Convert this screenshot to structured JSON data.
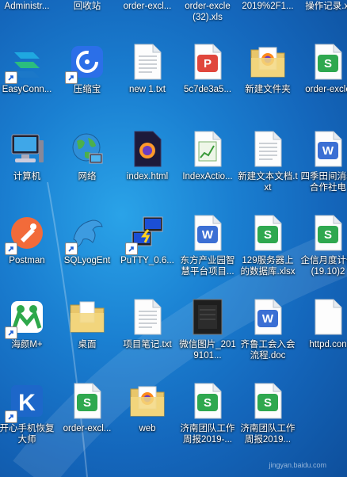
{
  "top_labels": [
    "Administr...",
    "回收站",
    "order-excl...",
    "order-excle\n(32).xls",
    "2019%2F1...",
    "操作记录.xl"
  ],
  "icons": [
    {
      "name": "desktop-icon-easyconnect",
      "label": "EasyConn...",
      "icon": "easyconnect-icon",
      "shortcut": true
    },
    {
      "name": "desktop-icon-yasuobao",
      "label": "压缩宝",
      "icon": "compress-icon",
      "shortcut": true
    },
    {
      "name": "desktop-icon-new1-txt",
      "label": "new 1.txt",
      "icon": "text-file-icon",
      "shortcut": false
    },
    {
      "name": "desktop-icon-5c7de3a5",
      "label": "5c7de3a5...",
      "icon": "ppt-file-icon",
      "shortcut": false
    },
    {
      "name": "desktop-icon-new-folder",
      "label": "新建文件夹",
      "icon": "folder-firefox-icon",
      "shortcut": false
    },
    {
      "name": "desktop-icon-order-excle-top",
      "label": "order-excle",
      "icon": "spreadsheet-icon",
      "shortcut": false
    },
    {
      "name": "desktop-icon-computer",
      "label": "计算机",
      "icon": "computer-icon",
      "shortcut": false
    },
    {
      "name": "desktop-icon-network",
      "label": "网络",
      "icon": "network-globe-icon",
      "shortcut": false
    },
    {
      "name": "desktop-icon-index-html",
      "label": "index.html",
      "icon": "firefox-file-icon",
      "shortcut": false
    },
    {
      "name": "desktop-icon-indexaction",
      "label": "IndexActio...",
      "icon": "chart-file-icon",
      "shortcut": false
    },
    {
      "name": "desktop-icon-new-txt-doc",
      "label": "新建文本文档.txt",
      "icon": "text-file-icon",
      "shortcut": false
    },
    {
      "name": "desktop-icon-sijitian",
      "label": "四季田间消着合作社电",
      "icon": "word-doc-icon",
      "shortcut": false
    },
    {
      "name": "desktop-icon-postman",
      "label": "Postman",
      "icon": "postman-icon",
      "shortcut": true
    },
    {
      "name": "desktop-icon-sqlyog",
      "label": "SQLyogEnt",
      "icon": "dolphin-icon",
      "shortcut": true
    },
    {
      "name": "desktop-icon-putty",
      "label": "PuTTY_0.6...",
      "icon": "putty-icon",
      "shortcut": true
    },
    {
      "name": "desktop-icon-dongfang",
      "label": "东方产业园智慧平台项目...",
      "icon": "word-doc-icon",
      "shortcut": false
    },
    {
      "name": "desktop-icon-129-server",
      "label": "129服务器上的数据库.xlsx",
      "icon": "spreadsheet-icon",
      "shortcut": false
    },
    {
      "name": "desktop-icon-qixinyue",
      "label": "企信月度计信(19.10)2",
      "icon": "spreadsheet-icon",
      "shortcut": false
    },
    {
      "name": "desktop-icon-haiyan",
      "label": "海颜M+",
      "icon": "haiyan-icon",
      "shortcut": true
    },
    {
      "name": "desktop-icon-zhuomian",
      "label": "桌面",
      "icon": "folder-doc-icon",
      "shortcut": false
    },
    {
      "name": "desktop-icon-xiangmu-biji",
      "label": "项目笔记.txt",
      "icon": "text-file-icon",
      "shortcut": false
    },
    {
      "name": "desktop-icon-weixin-pic",
      "label": "微信图片_2019101...",
      "icon": "image-thumb-icon",
      "shortcut": false
    },
    {
      "name": "desktop-icon-qilu-gonghui",
      "label": "齐鲁工会入会流程.doc",
      "icon": "word-doc-icon",
      "shortcut": false
    },
    {
      "name": "desktop-icon-httpd",
      "label": "httpd.con",
      "icon": "blank-file-icon",
      "shortcut": false
    },
    {
      "name": "desktop-icon-kaixin",
      "label": "开心手机恢复大师",
      "icon": "kaixin-icon",
      "shortcut": true
    },
    {
      "name": "desktop-icon-order-excl-bottom",
      "label": "order-excl...",
      "icon": "spreadsheet-icon",
      "shortcut": false
    },
    {
      "name": "desktop-icon-web",
      "label": "web",
      "icon": "folder-firefox-icon",
      "shortcut": false
    },
    {
      "name": "desktop-icon-jinan-1",
      "label": "济南团队工作周报2019-...",
      "icon": "spreadsheet-icon",
      "shortcut": false
    },
    {
      "name": "desktop-icon-jinan-2",
      "label": "济南团队工作周报2019...",
      "icon": "spreadsheet-icon",
      "shortcut": false
    }
  ],
  "watermark": "jingyan.baidu.com",
  "colors": {
    "wps_green": "#2fa84f",
    "word_blue": "#3b6fd4",
    "ppt_red": "#e0463c"
  }
}
